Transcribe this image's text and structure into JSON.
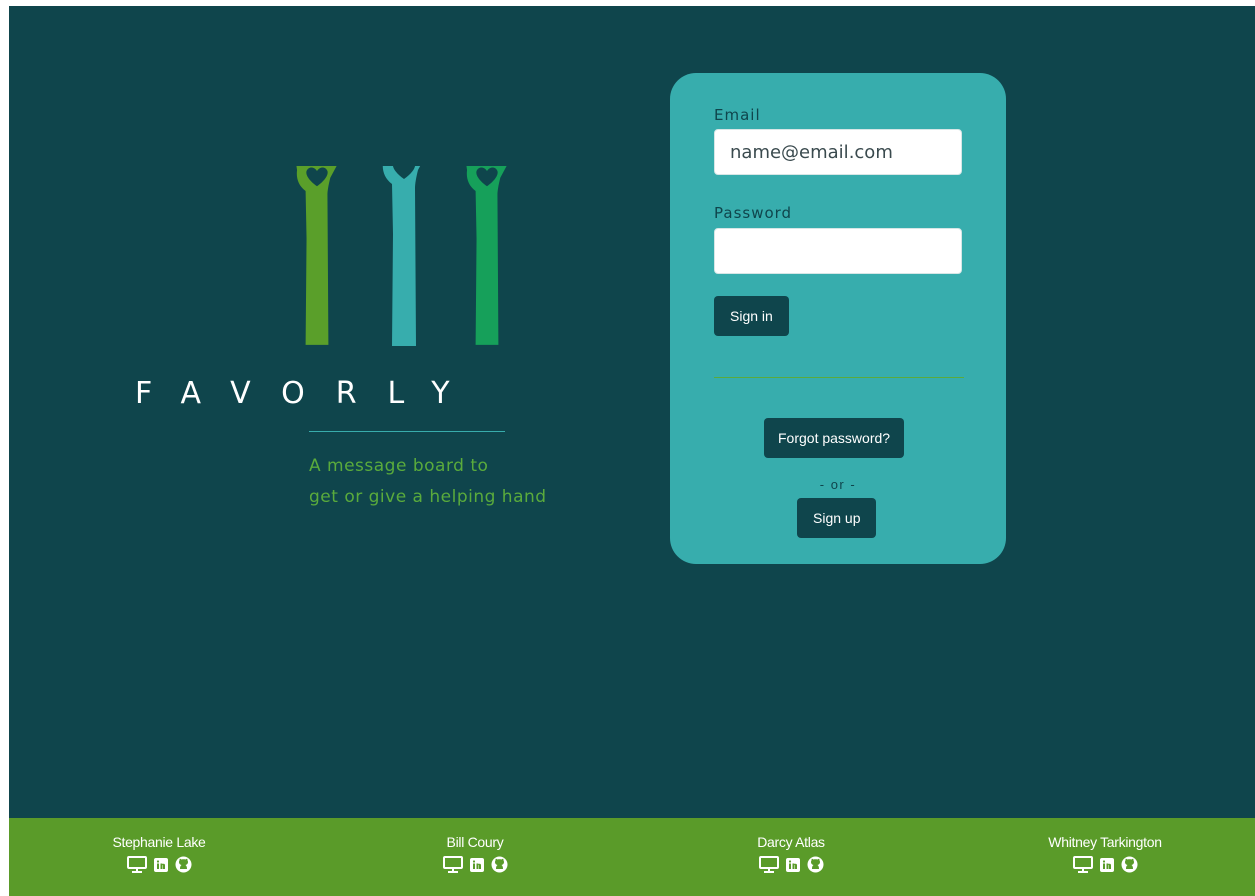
{
  "brand": {
    "name": "FAVORLY",
    "tagline_line1": "A message board to",
    "tagline_line2": "get or give a helping hand"
  },
  "login": {
    "email_label": "Email",
    "email_placeholder": "name@email.com",
    "password_label": "Password",
    "password_placeholder": "",
    "signin_label": "Sign in",
    "forgot_label": "Forgot password?",
    "or_text": "- or -",
    "signup_label": "Sign up"
  },
  "footer": {
    "members": [
      {
        "name": "Stephanie Lake",
        "icons": [
          "monitor-icon",
          "linkedin-icon",
          "github-icon"
        ]
      },
      {
        "name": "Bill Coury",
        "icons": [
          "monitor-icon",
          "linkedin-icon",
          "github-icon"
        ]
      },
      {
        "name": "Darcy Atlas",
        "icons": [
          "monitor-icon",
          "linkedin-icon",
          "github-icon"
        ]
      },
      {
        "name": "Whitney Tarkington",
        "icons": [
          "monitor-icon",
          "linkedin-icon",
          "github-icon"
        ]
      }
    ]
  },
  "colors": {
    "background": "#0f454c",
    "card": "#37adad",
    "button": "#0f454c",
    "footer": "#5a9b29",
    "accent_green": "#5aab3c",
    "hand_left": "#5a9f2a",
    "hand_middle": "#37adad",
    "hand_right": "#16a05a"
  }
}
